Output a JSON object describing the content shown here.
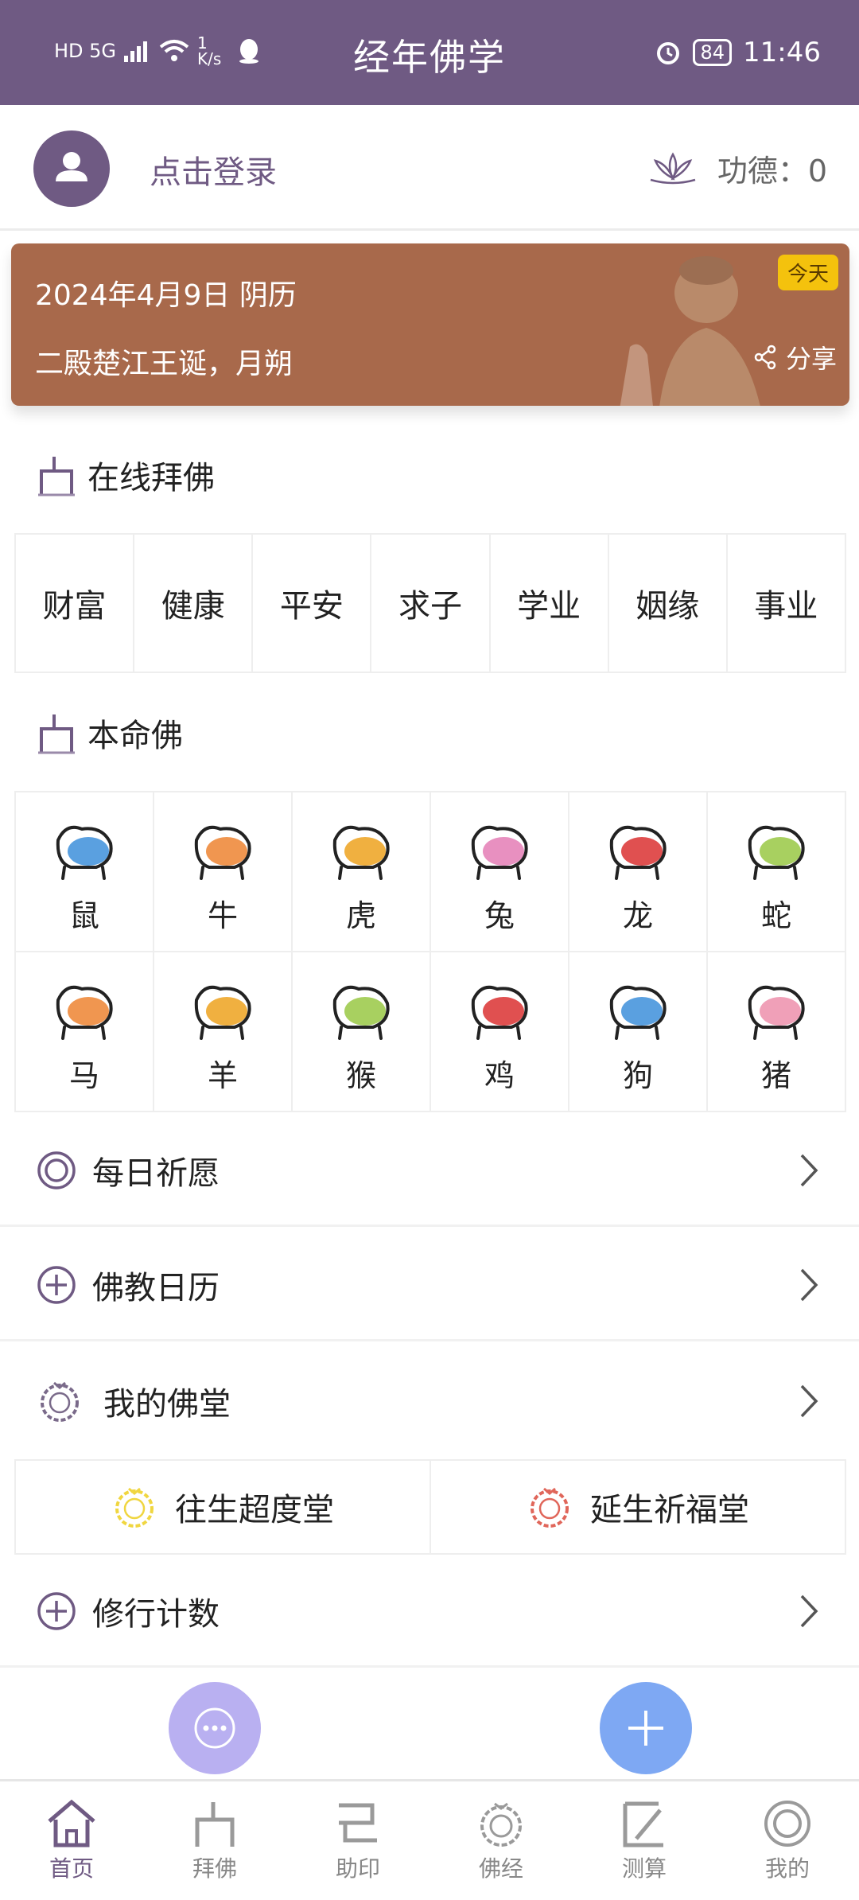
{
  "status_bar": {
    "left": "HD 5G",
    "speed": "1 K/s",
    "battery": "84",
    "time": "11:46"
  },
  "app": {
    "title": "经年佛学"
  },
  "login": {
    "text": "点击登录",
    "merit_label": "功德：0"
  },
  "banner": {
    "date": "2024年4月9日 阴历",
    "festival": "二殿楚江王诞，月朔",
    "today_badge": "今天",
    "share": "分享"
  },
  "online_worship": {
    "title": "在线拜佛",
    "items": [
      "财富",
      "健康",
      "平安",
      "求子",
      "学业",
      "姻缘",
      "事业"
    ]
  },
  "natal_buddha": {
    "title": "本命佛",
    "zodiac": [
      {
        "name": "鼠",
        "color": "#5aa0e0"
      },
      {
        "name": "牛",
        "color": "#f09650"
      },
      {
        "name": "虎",
        "color": "#f0b040"
      },
      {
        "name": "兔",
        "color": "#e890c0"
      },
      {
        "name": "龙",
        "color": "#e05050"
      },
      {
        "name": "蛇",
        "color": "#a8d060"
      },
      {
        "name": "马",
        "color": "#f09650"
      },
      {
        "name": "羊",
        "color": "#f0b040"
      },
      {
        "name": "猴",
        "color": "#a8d060"
      },
      {
        "name": "鸡",
        "color": "#e05050"
      },
      {
        "name": "狗",
        "color": "#5aa0e0"
      },
      {
        "name": "猪",
        "color": "#f0a0b8"
      }
    ]
  },
  "menu": {
    "daily_prayer": "每日祈愿",
    "calendar": "佛教日历",
    "my_hall": "我的佛堂",
    "hall_left": "往生超度堂",
    "hall_right": "延生祈福堂",
    "practice_count": "修行计数"
  },
  "tabs": [
    {
      "label": "首页",
      "icon": "home-icon"
    },
    {
      "label": "拜佛",
      "icon": "altar-icon"
    },
    {
      "label": "助印",
      "icon": "print-icon"
    },
    {
      "label": "佛经",
      "icon": "wreath-icon"
    },
    {
      "label": "测算",
      "icon": "calc-icon"
    },
    {
      "label": "我的",
      "icon": "profile-icon"
    }
  ],
  "colors": {
    "brand": "#6f5a83",
    "banner": "#a8694b",
    "badge": "#f4c20d"
  }
}
